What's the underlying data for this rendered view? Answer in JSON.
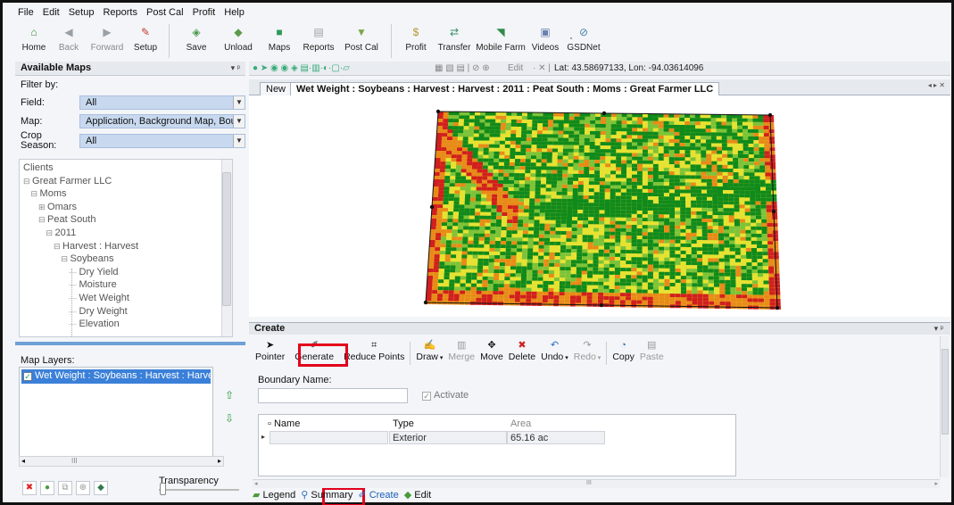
{
  "menu": [
    "File",
    "Edit",
    "Setup",
    "Reports",
    "Post Cal",
    "Profit",
    "Help"
  ],
  "toolbar": [
    {
      "label": "Home",
      "icon": "home-icon",
      "color": "#3e8d3a"
    },
    {
      "label": "Back",
      "icon": "back-icon",
      "color": "#9aa0a8",
      "disabled": true
    },
    {
      "label": "Forward",
      "icon": "forward-icon",
      "color": "#9aa0a8",
      "disabled": true
    },
    {
      "label": "Setup",
      "icon": "setup-icon",
      "color": "#c53b2f"
    },
    {
      "label": "Save",
      "icon": "save-icon",
      "color": "#4b9a4a"
    },
    {
      "label": "Unload",
      "icon": "unload-icon",
      "color": "#5a9b4a"
    },
    {
      "label": "Maps",
      "icon": "maps-icon",
      "color": "#2f9a5a"
    },
    {
      "label": "Reports",
      "icon": "reports-icon",
      "color": "#9aa0a8"
    },
    {
      "label": "Post Cal",
      "icon": "postcal-icon",
      "color": "#7aa84a"
    },
    {
      "label": "Profit",
      "icon": "profit-icon",
      "color": "#b8962e"
    },
    {
      "label": "Transfer",
      "icon": "transfer-icon",
      "color": "#3b8f6a"
    },
    {
      "label": "Mobile Farm",
      "icon": "mobile-farm-icon",
      "color": "#2f8a4a"
    },
    {
      "label": "Videos",
      "icon": "videos-icon",
      "color": "#6b7fb0"
    },
    {
      "label": "GSDNet",
      "icon": "gsdnet-icon",
      "color": "#4a7fa8"
    }
  ],
  "left": {
    "title": "Available Maps",
    "filter_by": "Filter by:",
    "field_label": "Field:",
    "field_value": "All",
    "map_label": "Map:",
    "map_value": "Application, Background Map, Boun",
    "crop_label": "Crop",
    "season_label": "Season:",
    "crop_value": "All",
    "tree": [
      {
        "text": "Clients",
        "level": 0
      },
      {
        "text": "Great Farmer LLC",
        "level": 0,
        "toggle": "⊟"
      },
      {
        "text": "Moms",
        "level": 1,
        "toggle": "⊟"
      },
      {
        "text": "Omars",
        "level": 2,
        "toggle": "⊞"
      },
      {
        "text": "Peat South",
        "level": 2,
        "toggle": "⊟"
      },
      {
        "text": "2011",
        "level": 3,
        "toggle": "⊟"
      },
      {
        "text": "Harvest : Harvest",
        "level": 4,
        "toggle": "⊟"
      },
      {
        "text": "Soybeans",
        "level": 5,
        "toggle": "⊟"
      },
      {
        "text": "Dry Yield",
        "level": 6
      },
      {
        "text": "Moisture",
        "level": 6
      },
      {
        "text": "Wet Weight",
        "level": 6
      },
      {
        "text": "Dry Weight",
        "level": 6
      },
      {
        "text": "Elevation",
        "level": 6
      }
    ],
    "map_layers_label": "Map Layers:",
    "layer": "Wet Weight : Soybeans : Harvest : Harvest :",
    "hscroll_thumb": "III",
    "transparency_label": "Transparency"
  },
  "maptoolbar": {
    "edit_label": "Edit",
    "coords": "Lat: 43.58697133, Lon: -94.03614096"
  },
  "tabs": {
    "new": "New",
    "active": "Wet Weight : Soybeans : Harvest : Harvest : 2011 : Peat South : Moms : Great Farmer LLC"
  },
  "create": {
    "title": "Create",
    "tools": [
      {
        "label": "Pointer",
        "icon": "pointer-icon"
      },
      {
        "label": "Generate",
        "icon": "generate-icon",
        "highlighted": true
      },
      {
        "label": "Reduce Points",
        "icon": "reduce-points-icon"
      },
      {
        "label": "Draw",
        "icon": "draw-icon",
        "caret": true
      },
      {
        "label": "Merge",
        "icon": "merge-icon",
        "disabled": true
      },
      {
        "label": "Move",
        "icon": "move-icon"
      },
      {
        "label": "Delete",
        "icon": "delete-icon"
      },
      {
        "label": "Undo",
        "icon": "undo-icon",
        "caret": true
      },
      {
        "label": "Redo",
        "icon": "redo-icon",
        "disabled": true,
        "caret": true
      },
      {
        "label": "Copy",
        "icon": "copy-icon"
      },
      {
        "label": "Paste",
        "icon": "paste-icon",
        "disabled": true
      }
    ],
    "boundary_name_label": "Boundary Name:",
    "boundary_name_value": "",
    "activate_label": "Activate",
    "table": {
      "columns": [
        "Name",
        "Type",
        "Area"
      ],
      "rows": [
        [
          "",
          "Exterior",
          "65.16 ac"
        ]
      ]
    },
    "bscroll_thumb": "III"
  },
  "bottom_tabs": [
    {
      "label": "Legend",
      "icon": "legend-icon"
    },
    {
      "label": "Summary",
      "icon": "summary-icon"
    },
    {
      "label": "Create",
      "icon": "create-icon",
      "active": true
    },
    {
      "label": "Edit",
      "icon": "edit-icon"
    }
  ],
  "colors": {
    "highlight": "#e3001b",
    "selection": "#3b80d8",
    "map_green": "#118a1c",
    "map_yellow": "#e6e233",
    "map_red": "#d11f1f"
  }
}
